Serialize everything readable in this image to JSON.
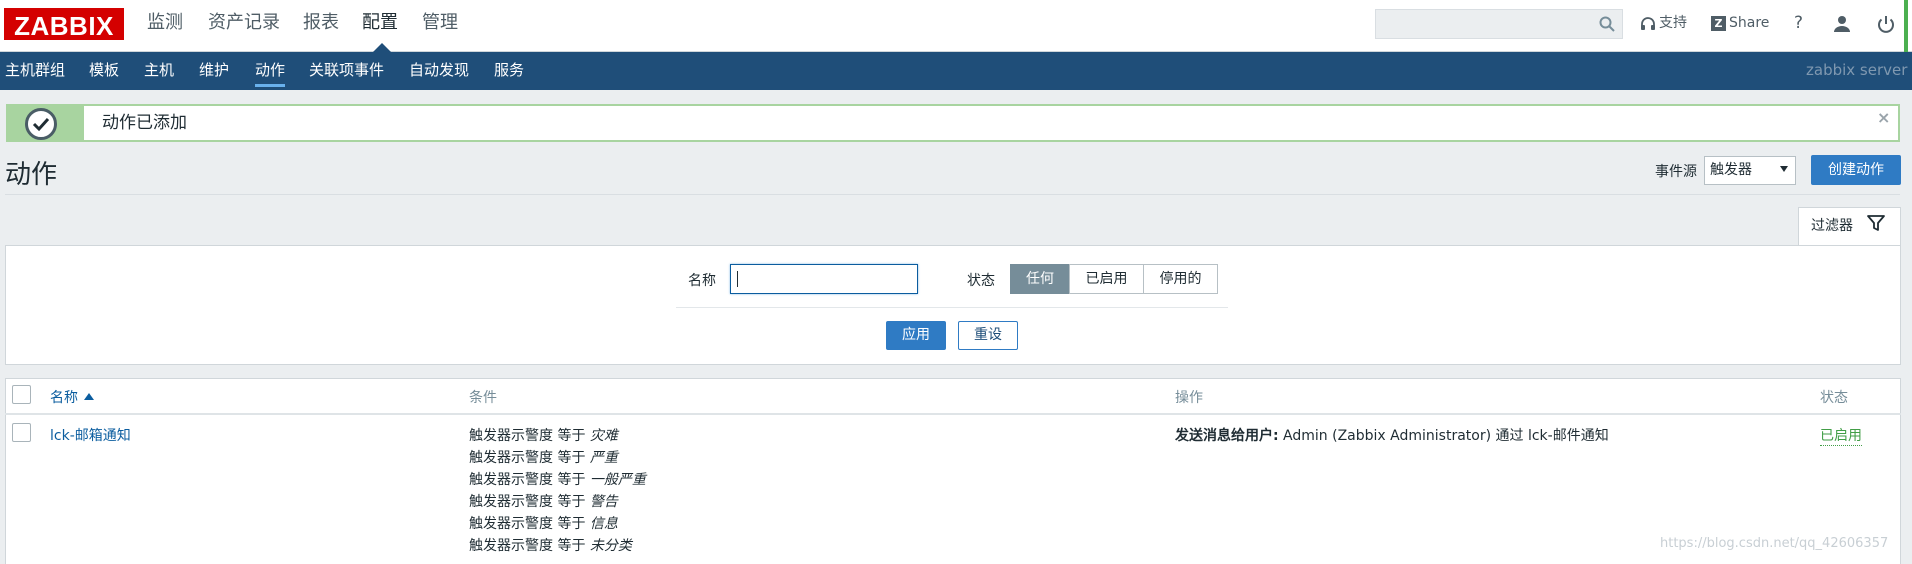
{
  "logo": "ZABBIX",
  "main_menu": [
    "监测",
    "资产记录",
    "报表",
    "配置",
    "管理"
  ],
  "main_menu_active": "配置",
  "top_links": {
    "support": "支持",
    "share": "Share",
    "help": "?"
  },
  "sub_menu": [
    "主机群组",
    "模板",
    "主机",
    "维护",
    "动作",
    "关联项事件",
    "自动发现",
    "服务"
  ],
  "sub_menu_active": "动作",
  "server_name": "zabbix server",
  "message": {
    "text": "动作已添加",
    "close": "×"
  },
  "page_title": "动作",
  "event_source": {
    "label": "事件源",
    "value": "触发器"
  },
  "create_button": "创建动作",
  "filter": {
    "tab_label": "过滤器",
    "name_label": "名称",
    "name_value": "",
    "status_label": "状态",
    "status_options": [
      "任何",
      "已启用",
      "停用的"
    ],
    "status_selected": "任何",
    "apply": "应用",
    "reset": "重设"
  },
  "table": {
    "headers": {
      "name": "名称",
      "conditions": "条件",
      "operations": "操作",
      "status": "状态"
    },
    "rows": [
      {
        "name": "lck-邮箱通知",
        "conditions": [
          {
            "prefix": "触发器示警度 等于 ",
            "value": "灾难"
          },
          {
            "prefix": "触发器示警度 等于 ",
            "value": "严重"
          },
          {
            "prefix": "触发器示警度 等于 ",
            "value": "一般严重"
          },
          {
            "prefix": "触发器示警度 等于 ",
            "value": "警告"
          },
          {
            "prefix": "触发器示警度 等于 ",
            "value": "信息"
          },
          {
            "prefix": "触发器示警度 等于 ",
            "value": "未分类"
          }
        ],
        "operation_label": "发送消息给用户:",
        "operation_text": " Admin (Zabbix Administrator) 通过 lck-邮件通知",
        "status": "已启用"
      }
    ]
  },
  "watermark": "https://blog.csdn.net/qq_42606357"
}
